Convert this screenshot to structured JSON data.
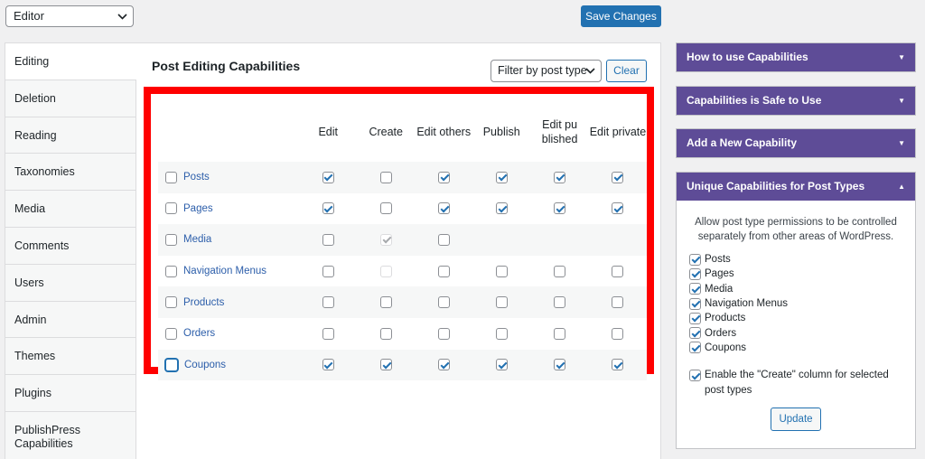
{
  "toolbar": {
    "role_value": "Editor",
    "save_label": "Save Changes"
  },
  "tabs": [
    "Editing",
    "Deletion",
    "Reading",
    "Taxonomies",
    "Media",
    "Comments",
    "Users",
    "Admin",
    "Themes",
    "Plugins",
    "PublishPress Capabilities"
  ],
  "content": {
    "title": "Post Editing Capabilities",
    "filter_label": "Filter by post type",
    "clear_label": "Clear"
  },
  "grid": {
    "columns": [
      "Edit",
      "Create",
      "Edit others",
      "Publish",
      "Edit published",
      "Edit private"
    ],
    "rows": [
      {
        "label": "Posts",
        "cells": [
          "checked",
          "unchecked",
          "checked",
          "checked",
          "checked",
          "checked"
        ]
      },
      {
        "label": "Pages",
        "cells": [
          "checked",
          "unchecked",
          "checked",
          "checked",
          "checked",
          "checked"
        ]
      },
      {
        "label": "Media",
        "cells": [
          "unchecked",
          "disabled-checked",
          "unchecked",
          "none",
          "none",
          "none"
        ]
      },
      {
        "label": "Navigation Menus",
        "cells": [
          "unchecked",
          "disabled",
          "unchecked",
          "unchecked",
          "unchecked",
          "unchecked"
        ]
      },
      {
        "label": "Products",
        "cells": [
          "unchecked",
          "unchecked",
          "unchecked",
          "unchecked",
          "unchecked",
          "unchecked"
        ]
      },
      {
        "label": "Orders",
        "cells": [
          "unchecked",
          "unchecked",
          "unchecked",
          "unchecked",
          "unchecked",
          "unchecked"
        ]
      },
      {
        "label": "Coupons",
        "cells": [
          "checked",
          "checked",
          "checked",
          "checked",
          "checked",
          "checked"
        ]
      }
    ]
  },
  "sidebar": {
    "boxes": [
      {
        "title": "How to use Capabilities"
      },
      {
        "title": "Capabilities is Safe to Use"
      },
      {
        "title": "Add a New Capability"
      }
    ],
    "unique": {
      "title": "Unique Capabilities for Post Types",
      "description": "Allow post type permissions to be controlled separately from other areas of WordPress.",
      "options": [
        "Posts",
        "Pages",
        "Media",
        "Navigation Menus",
        "Products",
        "Orders",
        "Coupons"
      ],
      "create_option": "Enable the \"Create\" column for selected post types",
      "update_label": "Update"
    }
  },
  "colors": {
    "accent": "#2271b1",
    "sidebar_header": "#5e4c97",
    "highlight_frame": "#ff0000"
  }
}
